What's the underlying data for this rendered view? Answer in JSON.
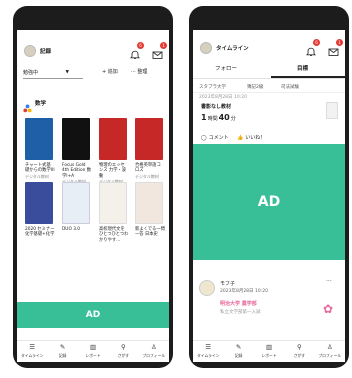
{
  "left_screen": {
    "header": {
      "title": "記録",
      "bell_badge": "6",
      "mail_badge": "1"
    },
    "toolbar": {
      "dropdown_value": "勉強中",
      "add_label": "+ 追加",
      "sort_label": "··· 整理"
    },
    "section_title": "数学",
    "books": [
      {
        "title": "チャート式基礎からの数学III",
        "type": "デジタル教材",
        "color": "#1e5fa8"
      },
      {
        "title": "Focus Gold 4th Edition 数学I+A",
        "type": "デジタル教材",
        "color": "#111111"
      },
      {
        "title": "物理のエッセンス 力学・波動",
        "type": "デジタル教材",
        "color": "#c62828"
      },
      {
        "title": "合格英単語コロズ",
        "type": "デジタル教材",
        "color": "#c62828"
      },
      {
        "title": "2020 セミナー化学基礎+化学",
        "type": "デジタル教材",
        "color": "#3a4d9c"
      },
      {
        "title": "DUO 3.0",
        "type": "",
        "color": "#e8eef5"
      },
      {
        "title": "高校現代文をひとつひとつわかりやす…",
        "type": "",
        "color": "#f4f1ea"
      },
      {
        "title": "新よくでる一問一答 日本史",
        "type": "",
        "color": "#f2e7df"
      }
    ],
    "ad_label": "AD",
    "nav": [
      "タイムライン",
      "記録",
      "レポート",
      "さがす",
      "プロフィール"
    ]
  },
  "right_screen": {
    "header": {
      "title": "タイムライン",
      "bell_badge": "6",
      "mail_badge": "1"
    },
    "tabs": [
      "フォロー",
      "目標"
    ],
    "chips": [
      "スタプラ大学",
      "簿記2級",
      "司法試験"
    ],
    "post1": {
      "timestamp": "2023年8月28日 10:20",
      "material": "書影なし教材",
      "duration_num1": "1",
      "duration_unit1": "時間",
      "duration_num2": "40",
      "duration_unit2": "分",
      "comment_label": "コメント",
      "like_label": "いいね！"
    },
    "ad_label": "AD",
    "post2": {
      "user": "モフ子",
      "timestamp": "2023年8月28日 10:20",
      "target": "明治大学 農学部",
      "subtext": "私立文学部第一入試"
    },
    "nav": [
      "タイムライン",
      "記録",
      "レポート",
      "さがす",
      "プロフィール"
    ]
  },
  "colors": {
    "accent": "#38bf97",
    "badge": "#e53935",
    "pink": "#e86a9c"
  }
}
